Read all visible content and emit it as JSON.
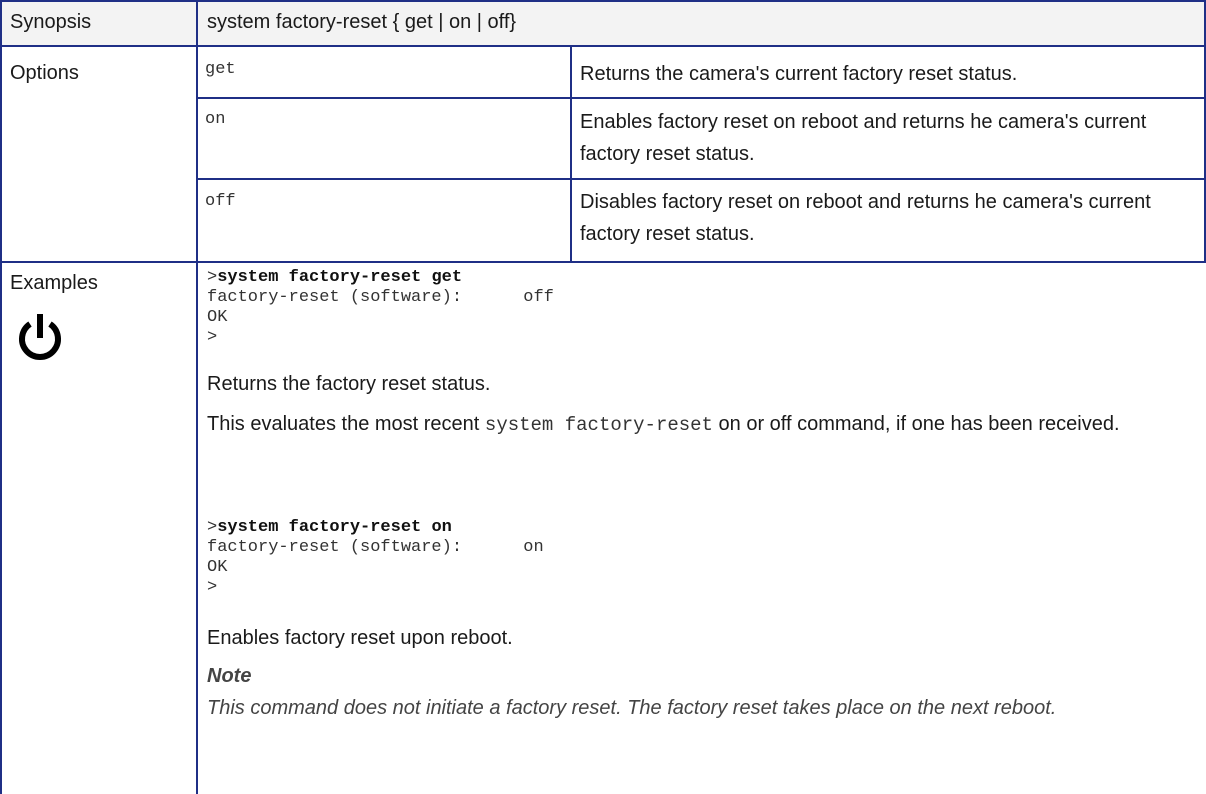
{
  "synopsis": {
    "label": "Synopsis",
    "text": "system factory-reset { get | on | off}"
  },
  "options": {
    "label": "Options",
    "items": [
      {
        "name": "get",
        "desc": "Returns the camera's current factory reset status."
      },
      {
        "name": "on",
        "desc": "Enables factory reset on reboot and returns he camera's current factory reset status."
      },
      {
        "name": "off",
        "desc": "Disables factory reset on reboot and returns he camera's current factory reset status."
      }
    ]
  },
  "examples": {
    "label": "Examples",
    "icon": "power-icon",
    "ex1": {
      "prompt": ">",
      "command": "system factory-reset get",
      "line2": "factory-reset (software):      off",
      "line3": "OK",
      "line4": ">"
    },
    "ex1_desc": "Returns the factory reset status.",
    "eval_before": "This evaluates the most recent ",
    "eval_code": "system factory-reset",
    "eval_after": " on or off command, if one has been received.",
    "ex2": {
      "prompt": ">",
      "command": "system factory-reset on",
      "line2": "factory-reset (software):      on",
      "line3": "OK",
      "line4": ">"
    },
    "ex2_desc": "Enables factory reset upon reboot.",
    "note_title": "Note",
    "note_body": "This command does not initiate a factory reset. The factory reset takes place on the next reboot."
  }
}
